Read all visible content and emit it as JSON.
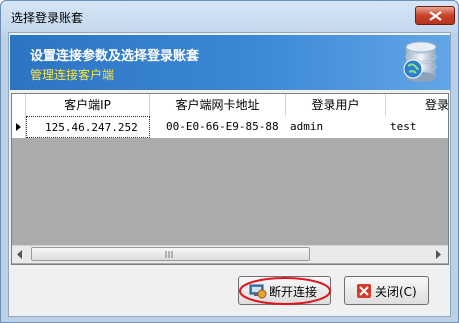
{
  "window": {
    "title": "选择登录账套"
  },
  "banner": {
    "title": "设置连接参数及选择登录账套",
    "subtitle": "管理连接客户端"
  },
  "table": {
    "columns": [
      "客户端IP",
      "客户端网卡地址",
      "登录用户",
      "登录"
    ],
    "rows": [
      [
        "125.46.247.252",
        "00-E0-66-E9-85-88",
        "admin",
        "test"
      ]
    ]
  },
  "buttons": {
    "disconnect": "断开连接",
    "close": "关闭(C)"
  },
  "colors": {
    "banner_bg": "#3b88d6",
    "subtitle": "#ffe53a",
    "highlight_ellipse": "#e0141e"
  },
  "icons": [
    "close-icon",
    "database-icon",
    "row-pointer-icon",
    "disconnect-icon",
    "close-x-icon"
  ]
}
